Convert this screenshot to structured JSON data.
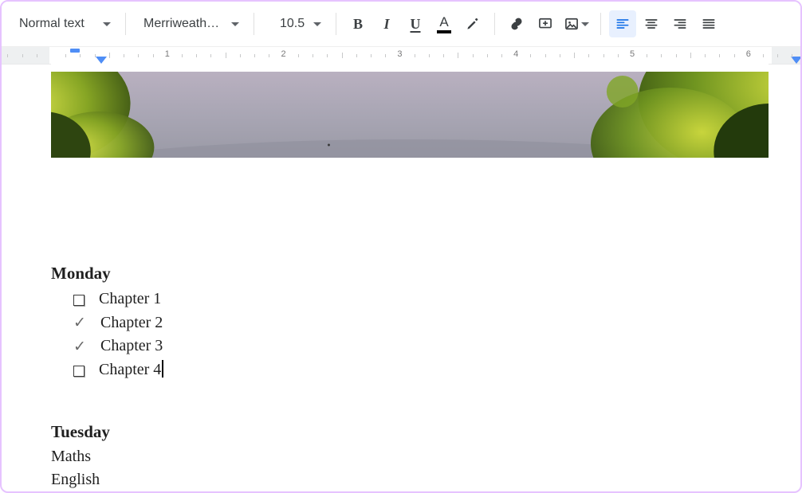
{
  "toolbar": {
    "style_label": "Normal text",
    "font_label": "Merriweath…",
    "font_size": "10.5"
  },
  "ruler": {
    "numbers": [
      "1",
      "2",
      "3",
      "4",
      "5",
      "6"
    ]
  },
  "document": {
    "sections": [
      {
        "heading": "Monday",
        "type": "checklist",
        "items": [
          {
            "checked": false,
            "label": "Chapter 1"
          },
          {
            "checked": true,
            "label": "Chapter 2"
          },
          {
            "checked": true,
            "label": "Chapter 3"
          },
          {
            "checked": false,
            "label": "Chapter 4",
            "cursor": true
          }
        ]
      },
      {
        "heading": "Tuesday",
        "type": "plain",
        "items": [
          {
            "label": "Maths"
          },
          {
            "label": "English"
          }
        ]
      }
    ]
  }
}
